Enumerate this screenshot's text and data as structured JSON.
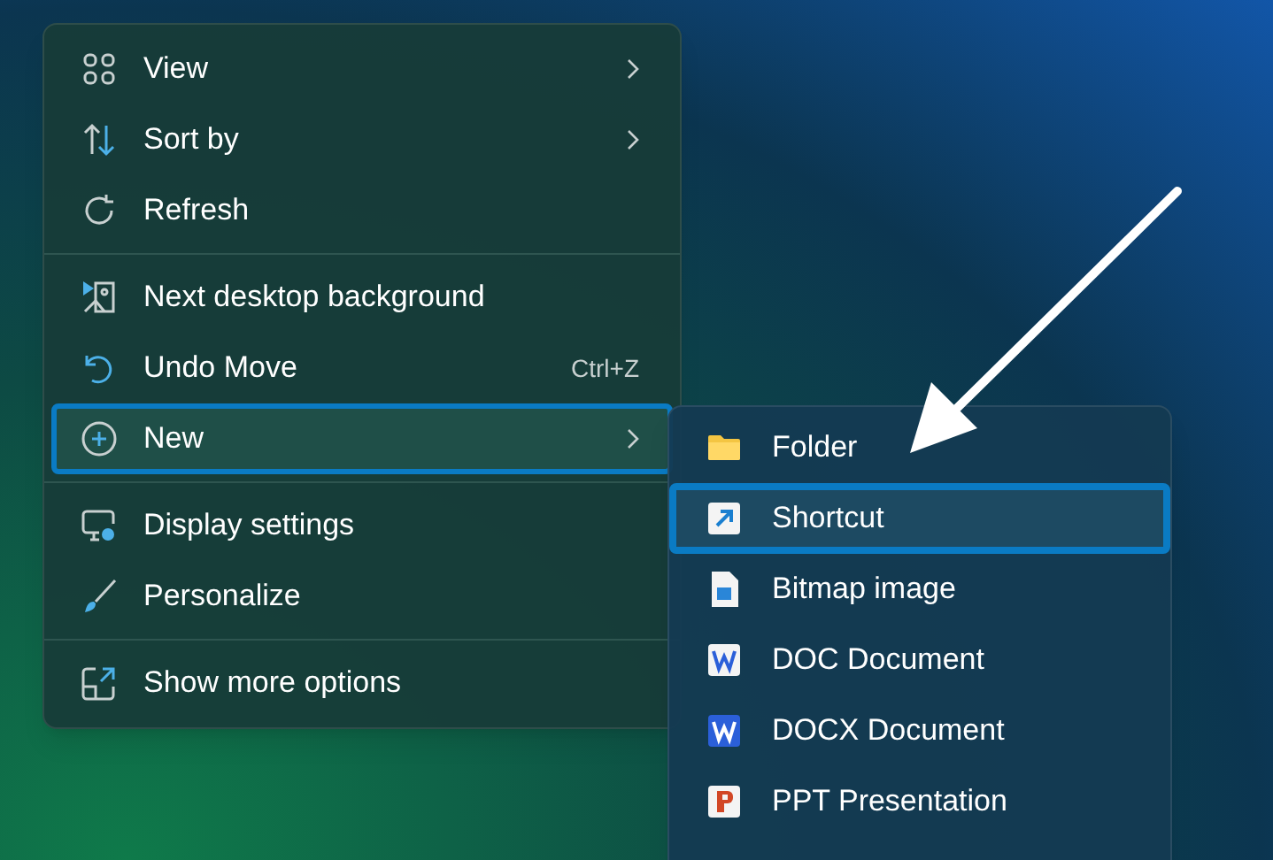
{
  "context_menu": {
    "groups": [
      {
        "items": [
          {
            "label": "View",
            "submenu": true,
            "selected": false
          },
          {
            "label": "Sort by",
            "submenu": true,
            "selected": false
          },
          {
            "label": "Refresh",
            "submenu": false,
            "selected": false
          }
        ]
      },
      {
        "items": [
          {
            "label": "Next desktop background",
            "submenu": false,
            "selected": false
          },
          {
            "label": "Undo Move",
            "shortcut": "Ctrl+Z",
            "submenu": false,
            "selected": false
          },
          {
            "label": "New",
            "submenu": true,
            "selected": true
          }
        ]
      },
      {
        "items": [
          {
            "label": "Display settings",
            "submenu": false,
            "selected": false
          },
          {
            "label": "Personalize",
            "submenu": false,
            "selected": false
          }
        ]
      },
      {
        "items": [
          {
            "label": "Show more options",
            "submenu": false,
            "selected": false
          }
        ]
      }
    ]
  },
  "new_submenu": {
    "items": [
      {
        "label": "Folder",
        "selected": false
      },
      {
        "label": "Shortcut",
        "selected": true
      },
      {
        "label": "Bitmap image",
        "selected": false
      },
      {
        "label": "DOC Document",
        "selected": false
      },
      {
        "label": "DOCX Document",
        "selected": false
      },
      {
        "label": "PPT Presentation",
        "selected": false
      }
    ]
  }
}
